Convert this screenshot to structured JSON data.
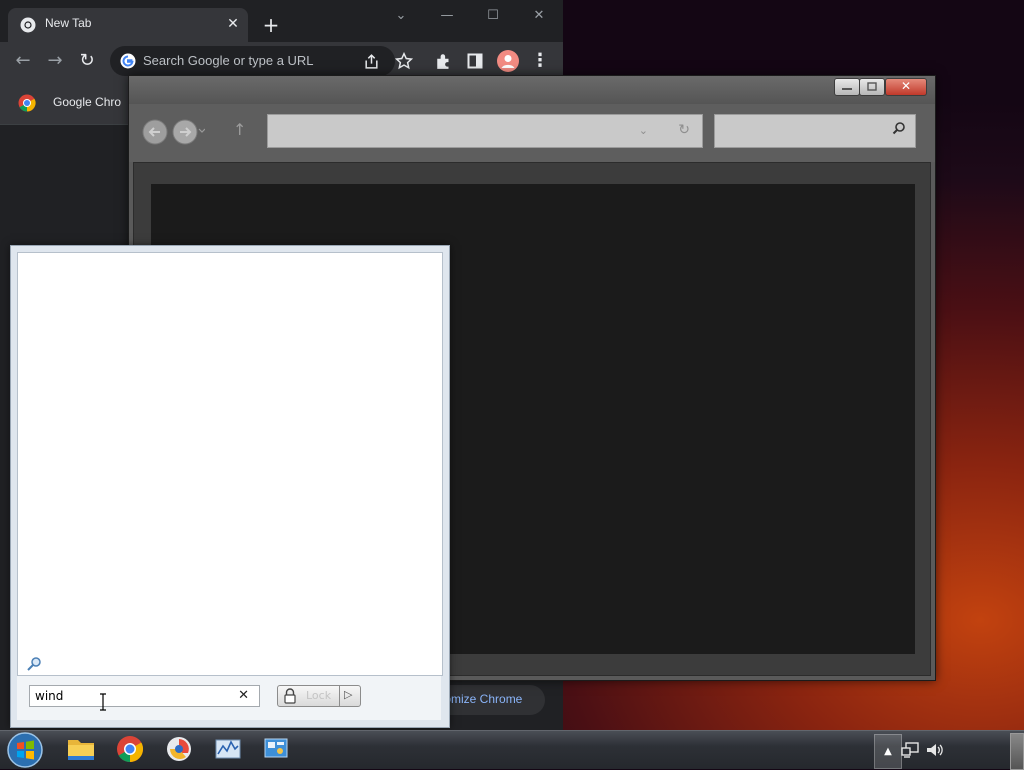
{
  "chrome": {
    "tab": {
      "title": "New Tab"
    },
    "omnibox": {
      "placeholder": "Search Google or type a URL"
    },
    "bookmarks": {
      "item": "Google Chro"
    },
    "customize": {
      "label": "tomize Chrome"
    }
  },
  "explorer": {
    "caption_buttons": [
      "minimize",
      "maximize",
      "close"
    ],
    "address_value": "",
    "search_value": ""
  },
  "start_menu": {
    "search": {
      "value": "wind",
      "clear_glyph": "✕"
    },
    "lock_button": {
      "label": "Lock"
    }
  },
  "taskbar": {
    "pinned": [
      "start-orb",
      "file-explorer",
      "google-chrome",
      "browser",
      "resource-monitor",
      "control-panel"
    ],
    "tray": [
      "show-hidden-icons",
      "network",
      "volume"
    ]
  },
  "colors": {
    "chrome_dark": "#202124",
    "chrome_toolbar": "#35363a",
    "accent_link": "#8ab4f8",
    "explorer_body": "#1b1b1b",
    "taskbar": "#2d3036"
  }
}
